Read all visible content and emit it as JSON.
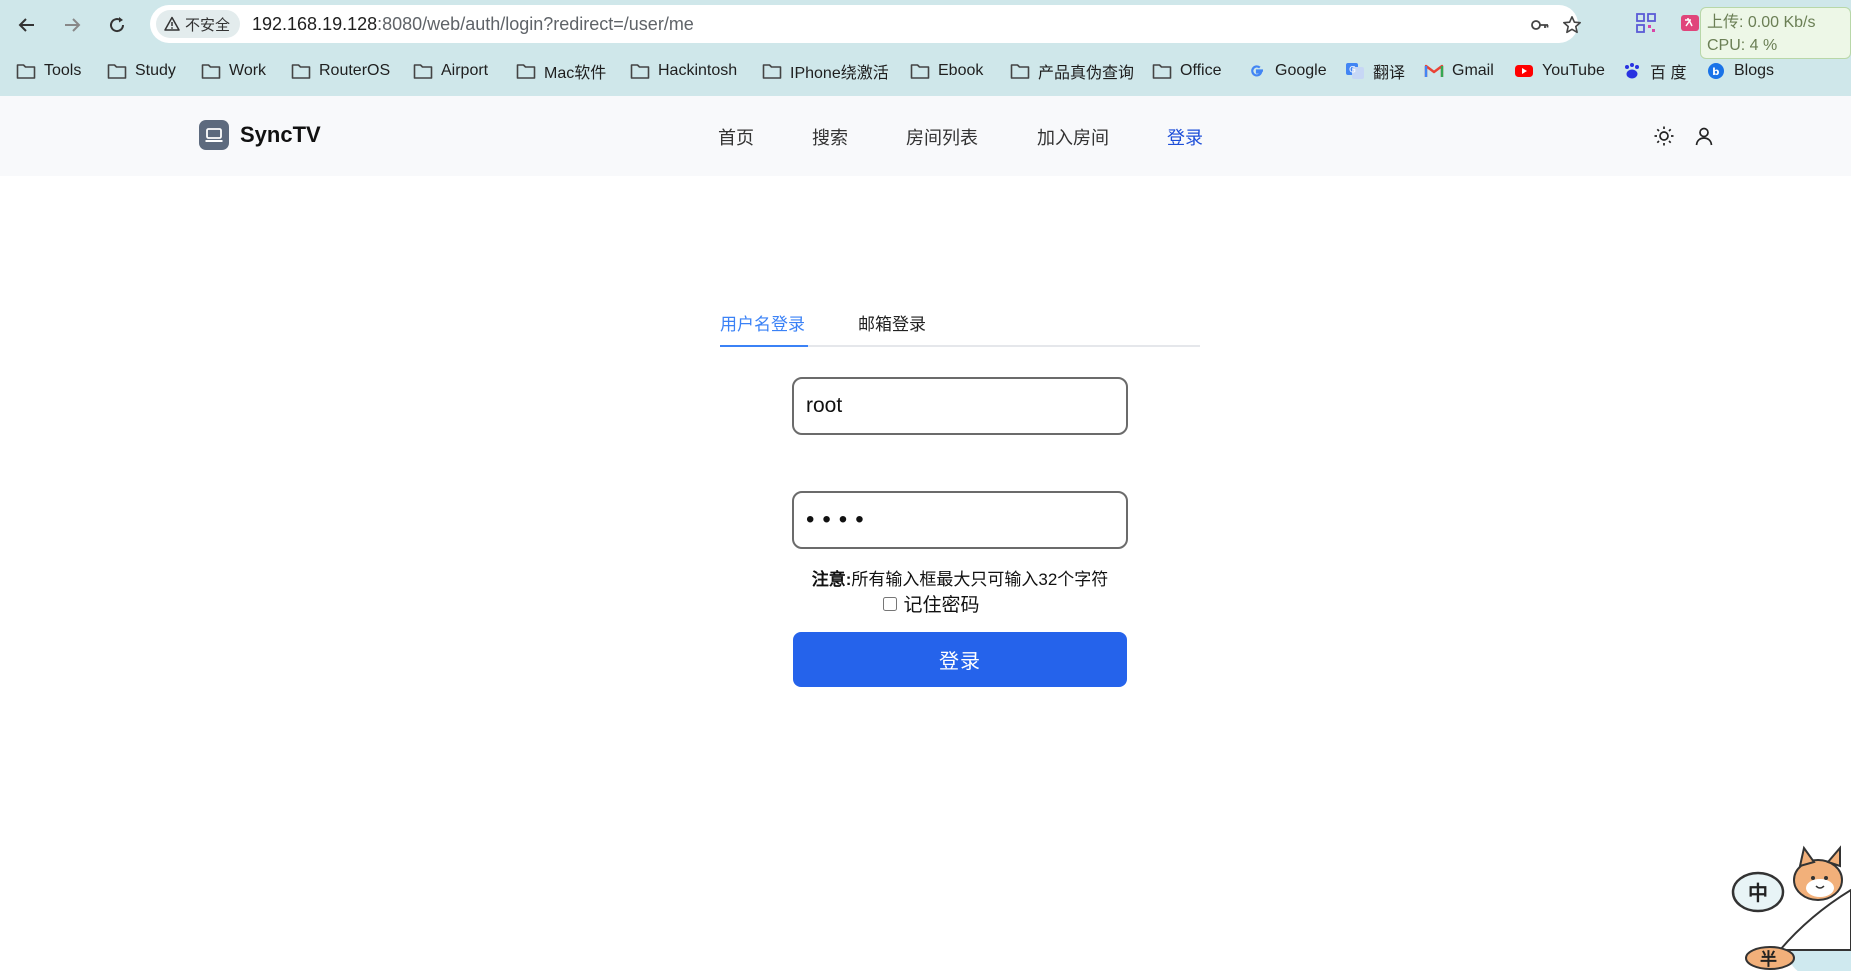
{
  "browser": {
    "security_label": "不安全",
    "url_host": "192.168.19.128",
    "url_rest": ":8080/web/auth/login?redirect=/user/me",
    "net_monitor": {
      "upload": "上传: 0.00 Kb/s",
      "cpu": "CPU: 4 %"
    },
    "bookmarks": [
      {
        "label": "Tools",
        "icon": "folder-icon"
      },
      {
        "label": "Study",
        "icon": "folder-icon"
      },
      {
        "label": "Work",
        "icon": "folder-icon"
      },
      {
        "label": "RouterOS",
        "icon": "folder-icon"
      },
      {
        "label": "Airport",
        "icon": "folder-icon"
      },
      {
        "label": "Mac软件",
        "icon": "folder-icon"
      },
      {
        "label": "Hackintosh",
        "icon": "folder-icon"
      },
      {
        "label": "IPhone绕激活",
        "icon": "folder-icon"
      },
      {
        "label": "Ebook",
        "icon": "folder-icon"
      },
      {
        "label": "产品真伪查询",
        "icon": "folder-icon"
      },
      {
        "label": "Office",
        "icon": "folder-icon"
      },
      {
        "label": "Google",
        "icon": "google-icon"
      },
      {
        "label": "翻译",
        "icon": "translate-icon"
      },
      {
        "label": "Gmail",
        "icon": "gmail-icon"
      },
      {
        "label": "YouTube",
        "icon": "youtube-icon"
      },
      {
        "label": "百 度",
        "icon": "baidu-icon"
      },
      {
        "label": "Blogs",
        "icon": "blogs-icon"
      }
    ]
  },
  "app": {
    "brand": "SyncTV",
    "nav": [
      "首页",
      "搜索",
      "房间列表",
      "加入房间",
      "登录"
    ],
    "active_nav": "登录"
  },
  "login": {
    "tabs": [
      "用户名登录",
      "邮箱登录"
    ],
    "active_tab": "用户名登录",
    "username_value": "root",
    "password_value": "1234",
    "note_label": "注意:",
    "note_text": "所有输入框最大只可输入32个字符",
    "remember_label": "记住密码",
    "remember_checked": false,
    "submit_label": "登录"
  },
  "colors": {
    "chrome_bg": "#cfe7ea",
    "accent": "#2563eb",
    "tab_active": "#3b82f6",
    "nav_active": "#1d4ed8"
  },
  "mascot": {
    "badge_top": "中",
    "badge_bottom": "半"
  }
}
